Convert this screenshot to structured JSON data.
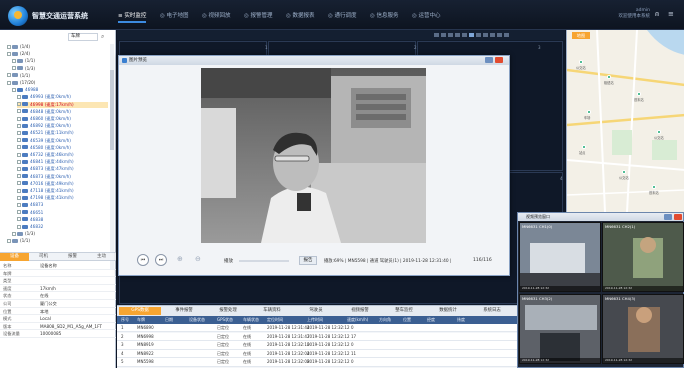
{
  "header": {
    "app_title": "智慧交通运营系统",
    "nav": [
      "≡ 实时监控",
      "◎ 电子地图",
      "◎ 视频回放",
      "◎ 报警管理",
      "◎ 数据报表",
      "◎ 通行调度",
      "◎ 信息服务",
      "◎ 运营中心"
    ],
    "top_right_line1": "admin",
    "top_right_line2": "欢迎使用本系统",
    "icons": [
      "user-icon",
      "menu-icon"
    ]
  },
  "sidebar": {
    "search_select": "车牌",
    "tree": [
      {
        "label": "(1/4)",
        "type": "group",
        "level": 1
      },
      {
        "label": "(2/4)",
        "type": "group",
        "level": 1
      },
      {
        "label": "(1/1)",
        "type": "group",
        "level": 2
      },
      {
        "label": "(1/3)",
        "type": "group",
        "level": 2
      },
      {
        "label": "(1/1)",
        "type": "group",
        "level": 1
      },
      {
        "label": "(17/20)",
        "type": "group",
        "level": 1
      },
      {
        "label": "46988",
        "type": "bus",
        "level": 2
      },
      {
        "label": "46993 (速度:0km/h)",
        "type": "bus",
        "level": 3
      },
      {
        "label": "46998 (速度:17km/h)",
        "type": "bus",
        "level": 3,
        "selected": true
      },
      {
        "label": "46848 (速度:0km/h)",
        "type": "bus",
        "level": 3
      },
      {
        "label": "46860 (速度:0km/h)",
        "type": "bus",
        "level": 3
      },
      {
        "label": "46892 (速度:0km/h)",
        "type": "bus",
        "level": 3
      },
      {
        "label": "46521 (速度:11km/h)",
        "type": "bus",
        "level": 3
      },
      {
        "label": "46539 (速度:0km/h)",
        "type": "bus",
        "level": 3
      },
      {
        "label": "46580 (速度:0km/h)",
        "type": "bus",
        "level": 3
      },
      {
        "label": "46732 (速度:46km/h)",
        "type": "bus",
        "level": 3
      },
      {
        "label": "46841 (速度:44km/h)",
        "type": "bus",
        "level": 3
      },
      {
        "label": "46873 (速度:47km/h)",
        "type": "bus",
        "level": 3
      },
      {
        "label": "46873 (速度:0km/h)",
        "type": "bus",
        "level": 3
      },
      {
        "label": "47016 (速度:49km/h)",
        "type": "bus",
        "level": 3
      },
      {
        "label": "47118 (速度:41km/h)",
        "type": "bus",
        "level": 3
      },
      {
        "label": "47198 (速度:41km/h)",
        "type": "bus",
        "level": 3
      },
      {
        "label": "46873",
        "type": "bus",
        "level": 3
      },
      {
        "label": "46651",
        "type": "bus",
        "level": 3
      },
      {
        "label": "46838",
        "type": "bus",
        "level": 3
      },
      {
        "label": "46832",
        "type": "bus",
        "level": 3
      },
      {
        "label": "(1/3)",
        "type": "group",
        "level": 2
      },
      {
        "label": "(1/1)",
        "type": "group",
        "level": 1
      }
    ],
    "info_tabs": [
      "设备",
      "司机",
      "报警",
      "主动"
    ],
    "info_rows": [
      {
        "k": "名称",
        "v": "设备名称"
      },
      {
        "k": "车牌",
        "v": ""
      },
      {
        "k": "类型",
        "v": ""
      },
      {
        "k": "速度",
        "v": "17km/h"
      },
      {
        "k": "状态",
        "v": "在线"
      },
      {
        "k": "公司",
        "v": "厦门公交"
      },
      {
        "k": "位置",
        "v": "本地"
      },
      {
        "k": "模式",
        "v": "Local"
      },
      {
        "k": "版本",
        "v": "MA808_SD2_M1_A5g_AM_1FT"
      },
      {
        "k": "设备流量",
        "v": "10000085"
      }
    ]
  },
  "dialog": {
    "title": "图片预览",
    "speed_label": "播放",
    "report_label": "报告",
    "playback_status": "播放:69% | MN5598 | 通道 驾驶员(1) | 2019-11-28 12:31:40 |",
    "counter": "116/116",
    "controls": [
      "prev-icon",
      "next-icon",
      "zoom-in-icon",
      "zoom-out-icon"
    ]
  },
  "grid": {
    "cell_numbers": [
      "1",
      "2",
      "3",
      "4"
    ]
  },
  "bottom_table": {
    "tabs": [
      "GPS数据",
      "事件报警",
      "报警处理",
      "车辆资料",
      "驾驶员",
      "视频报警",
      "整车监控",
      "数据统计",
      "系统日志"
    ],
    "headers": [
      "序号",
      "车牌",
      "日期",
      "设备状态",
      "GPS状态",
      "车辆状态",
      "定位时间",
      "上传时间",
      "速度(km/h)",
      "方向角",
      "位置",
      "经度",
      "纬度"
    ],
    "rows": [
      [
        "1",
        "MN6890",
        "已定位",
        "在线",
        "2019-11-28 12:31:44",
        "2019-11-28 12:32:12",
        "0"
      ],
      [
        "2",
        "MN6998",
        "已定位",
        "在线",
        "2019-11-28 12:31:47",
        "2019-11-28 12:32:12",
        "17"
      ],
      [
        "3",
        "MN8919",
        "已定位",
        "在线",
        "2019-11-28 12:32:10",
        "2019-11-28 12:32:12",
        "0"
      ],
      [
        "4",
        "MN8922",
        "已定位",
        "在线",
        "2019-11-28 12:32:04",
        "2019-11-28 12:32:12",
        "11"
      ],
      [
        "5",
        "MN5598",
        "已定位",
        "在线",
        "2019-11-28 12:32:08",
        "2019-11-28 12:32:12",
        "0"
      ]
    ]
  },
  "map": {
    "tab": "地图",
    "labels": [
      "公交站",
      "枢纽站",
      "首末站",
      "车场",
      "公交站",
      "站点",
      "公交站",
      "首末站"
    ]
  },
  "cam_window": {
    "title": "视频预览窗口",
    "cams": [
      "MN6631 CH1(0)",
      "MN6631 CH2(1)",
      "MN6631 CH3(2)",
      "MN6631 CH4(3)"
    ],
    "cam_bottom": "2019-11-28 12:32"
  },
  "colors": {
    "accent": "#f7a531",
    "header_bg": "#172132",
    "table_head": "#3b5f92",
    "selected_row": "#fce6b3"
  }
}
